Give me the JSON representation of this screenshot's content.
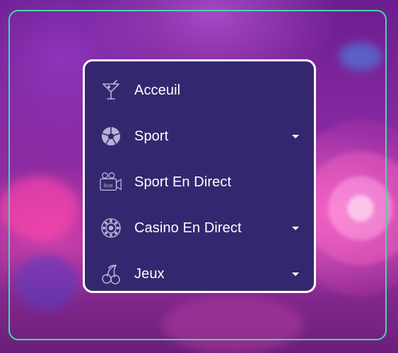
{
  "colors": {
    "frame_border": "#3fdca0",
    "menu_background": "#35276f",
    "menu_border": "#ffffff",
    "text": "#ffffff",
    "icon": "#b9b2d6"
  },
  "menu": {
    "items": [
      {
        "label": "Acceuil",
        "icon": "cocktail-icon",
        "has_submenu": false
      },
      {
        "label": "Sport",
        "icon": "soccer-ball-icon",
        "has_submenu": true
      },
      {
        "label": "Sport En Direct",
        "icon": "live-camera-icon",
        "icon_text": "live",
        "has_submenu": false
      },
      {
        "label": "Casino En Direct",
        "icon": "casino-chip-icon",
        "has_submenu": true
      },
      {
        "label": "Jeux",
        "icon": "cherries-icon",
        "has_submenu": true
      }
    ]
  }
}
